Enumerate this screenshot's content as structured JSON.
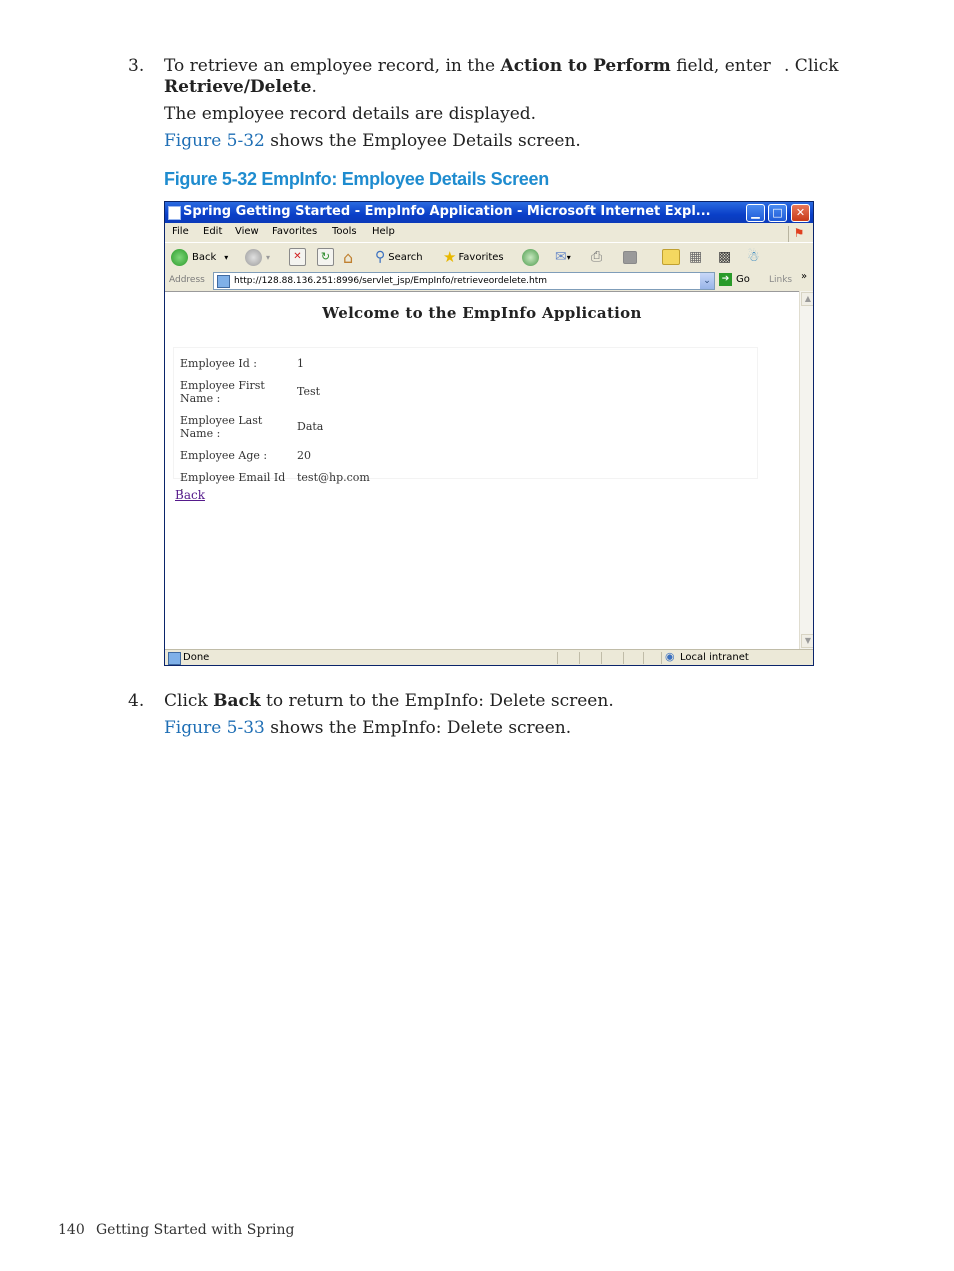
{
  "step3": {
    "number": "3.",
    "line1_a": "To retrieve an employee record, in the ",
    "line1_b": "Action to Perform",
    "line1_c": " field, enter",
    "line1_d": ". Click",
    "line2_b": "Retrieve/Delete",
    "line2_c": ".",
    "details": "The employee record details are displayed.",
    "fig_ref": "Figure 5-32",
    "fig_ref_rest": " shows the Employee Details screen."
  },
  "figure": {
    "caption": "Figure 5-32 EmpInfo: Employee Details Screen"
  },
  "browser": {
    "title": "Spring Getting Started - EmpInfo Application - Microsoft Internet Expl...",
    "menu": [
      "File",
      "Edit",
      "View",
      "Favorites",
      "Tools",
      "Help"
    ],
    "toolbar": {
      "back": "Back",
      "search": "Search",
      "favorites": "Favorites"
    },
    "address_label": "Address",
    "address": "http://128.88.136.251:8996/servlet_jsp/EmpInfo/retrieveordelete.htm",
    "go": "Go",
    "links": "Links",
    "status": "Done",
    "zone": "Local intranet",
    "page": {
      "heading": "Welcome to the EmpInfo Application",
      "fields": [
        {
          "label": "Employee Id :",
          "value": "1"
        },
        {
          "label": "Employee First Name :",
          "value": "Test"
        },
        {
          "label": "Employee Last Name :",
          "value": "Data"
        },
        {
          "label": "Employee Age :",
          "value": "20"
        },
        {
          "label": "Employee Email Id :",
          "value": "test@hp.com"
        }
      ],
      "back_link": "Back"
    }
  },
  "step4": {
    "number": "4.",
    "line1_a": "Click ",
    "line1_b": "Back",
    "line1_c": " to return to the EmpInfo: Delete screen.",
    "fig_ref": "Figure 5-33",
    "fig_ref_rest": " shows the EmpInfo: Delete screen."
  },
  "footer": {
    "page_number": "140",
    "title": "Getting Started with Spring"
  }
}
